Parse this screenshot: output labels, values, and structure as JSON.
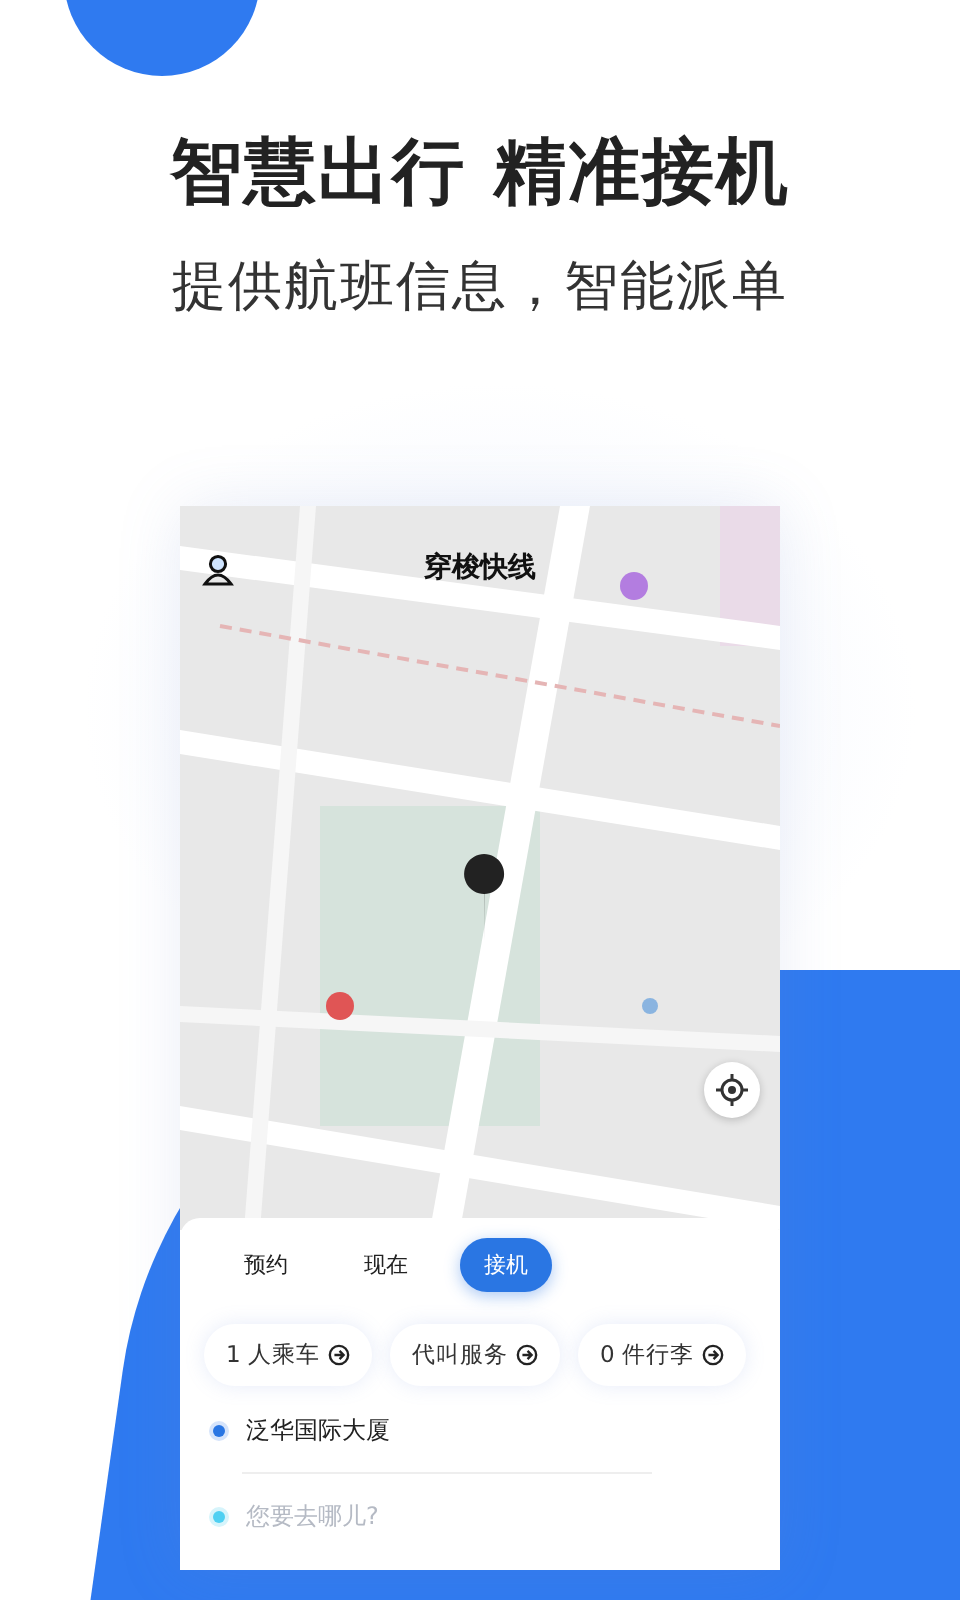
{
  "headline": "智慧出行 精准接机",
  "subtitle": "提供航班信息，智能派单",
  "app": {
    "title": "穿梭快线",
    "modes": [
      {
        "label": "预约",
        "selected": false
      },
      {
        "label": "现在",
        "selected": false
      },
      {
        "label": "接机",
        "selected": true
      }
    ],
    "options": [
      {
        "label": "1 人乘车"
      },
      {
        "label": "代叫服务"
      },
      {
        "label": "0 件行李"
      }
    ],
    "route": {
      "origin": "泛华国际大厦",
      "destination": {
        "placeholder": "您要去哪儿?"
      }
    }
  }
}
